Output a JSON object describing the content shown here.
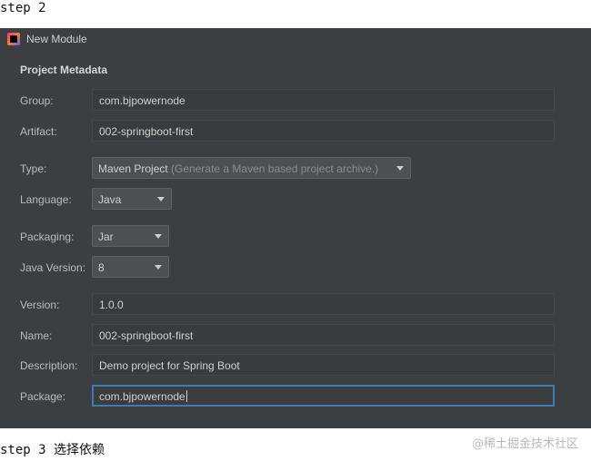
{
  "captions": {
    "top": "step 2",
    "bottom": "step 3 选择依赖",
    "watermark": "@稀土掘金技术社区"
  },
  "window": {
    "title": "New Module",
    "section_title": "Project Metadata"
  },
  "fields": {
    "group": {
      "label": "Group:",
      "value": "com.bjpowernode"
    },
    "artifact": {
      "label": "Artifact:",
      "value": "002-springboot-first"
    },
    "type": {
      "label": "Type:",
      "value": "Maven Project",
      "hint": "(Generate a Maven based project archive.)"
    },
    "language": {
      "label": "Language:",
      "value": "Java"
    },
    "packaging": {
      "label": "Packaging:",
      "value": "Jar"
    },
    "java_version": {
      "label": "Java Version:",
      "value": "8"
    },
    "version": {
      "label": "Version:",
      "value": "1.0.0"
    },
    "name": {
      "label": "Name:",
      "value": "002-springboot-first"
    },
    "description": {
      "label": "Description:",
      "value": "Demo project for Spring Boot"
    },
    "package": {
      "label": "Package:",
      "value": "com.bjpowernode"
    }
  },
  "colors": {
    "dialog_background": "#3c3f41",
    "focus_border": "#3d7ab8"
  }
}
